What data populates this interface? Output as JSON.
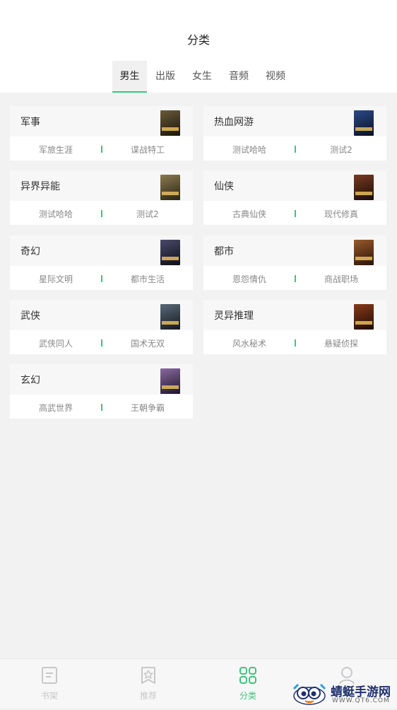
{
  "header": {
    "title": "分类"
  },
  "tabs": [
    {
      "label": "男生",
      "active": true
    },
    {
      "label": "出版"
    },
    {
      "label": "女生"
    },
    {
      "label": "音频"
    },
    {
      "label": "视频"
    }
  ],
  "categories": [
    {
      "title": "军事",
      "subs": [
        "军旅生涯",
        "谍战特工"
      ],
      "cover_color": "#2a2418"
    },
    {
      "title": "热血网游",
      "subs": [
        "测试哈哈",
        "测试2"
      ],
      "cover_color": "#101a3a"
    },
    {
      "title": "异界异能",
      "subs": [
        "测试哈哈",
        "测试2"
      ],
      "cover_color": "#3a3420"
    },
    {
      "title": "仙侠",
      "subs": [
        "古典仙侠",
        "现代修真"
      ],
      "cover_color": "#3a1c14"
    },
    {
      "title": "奇幻",
      "subs": [
        "星际文明",
        "都市生活"
      ],
      "cover_color": "#1c1c2a"
    },
    {
      "title": "都市",
      "subs": [
        "恩怨情仇",
        "商战职场"
      ],
      "cover_color": "#4a2614"
    },
    {
      "title": "武侠",
      "subs": [
        "武侠同人",
        "国术无双"
      ],
      "cover_color": "#283038"
    },
    {
      "title": "灵异推理",
      "subs": [
        "风水秘术",
        "悬疑侦探"
      ],
      "cover_color": "#3a1a10"
    },
    {
      "title": "玄幻",
      "subs": [
        "高武世界",
        "王朝争霸"
      ],
      "cover_color": "#3a2a4a"
    }
  ],
  "bottom_nav": [
    {
      "label": "书架",
      "icon": "bookshelf-icon",
      "active": false
    },
    {
      "label": "推荐",
      "icon": "star-icon",
      "active": false
    },
    {
      "label": "分类",
      "icon": "grid-icon",
      "active": true
    },
    {
      "label": "",
      "icon": "profile-icon",
      "active": false
    }
  ],
  "watermark": {
    "text": "蜻蜓手游网",
    "url": "WWW.QT6.COM"
  },
  "colors": {
    "accent": "#3dc47e",
    "background": "#f2f2f2"
  }
}
